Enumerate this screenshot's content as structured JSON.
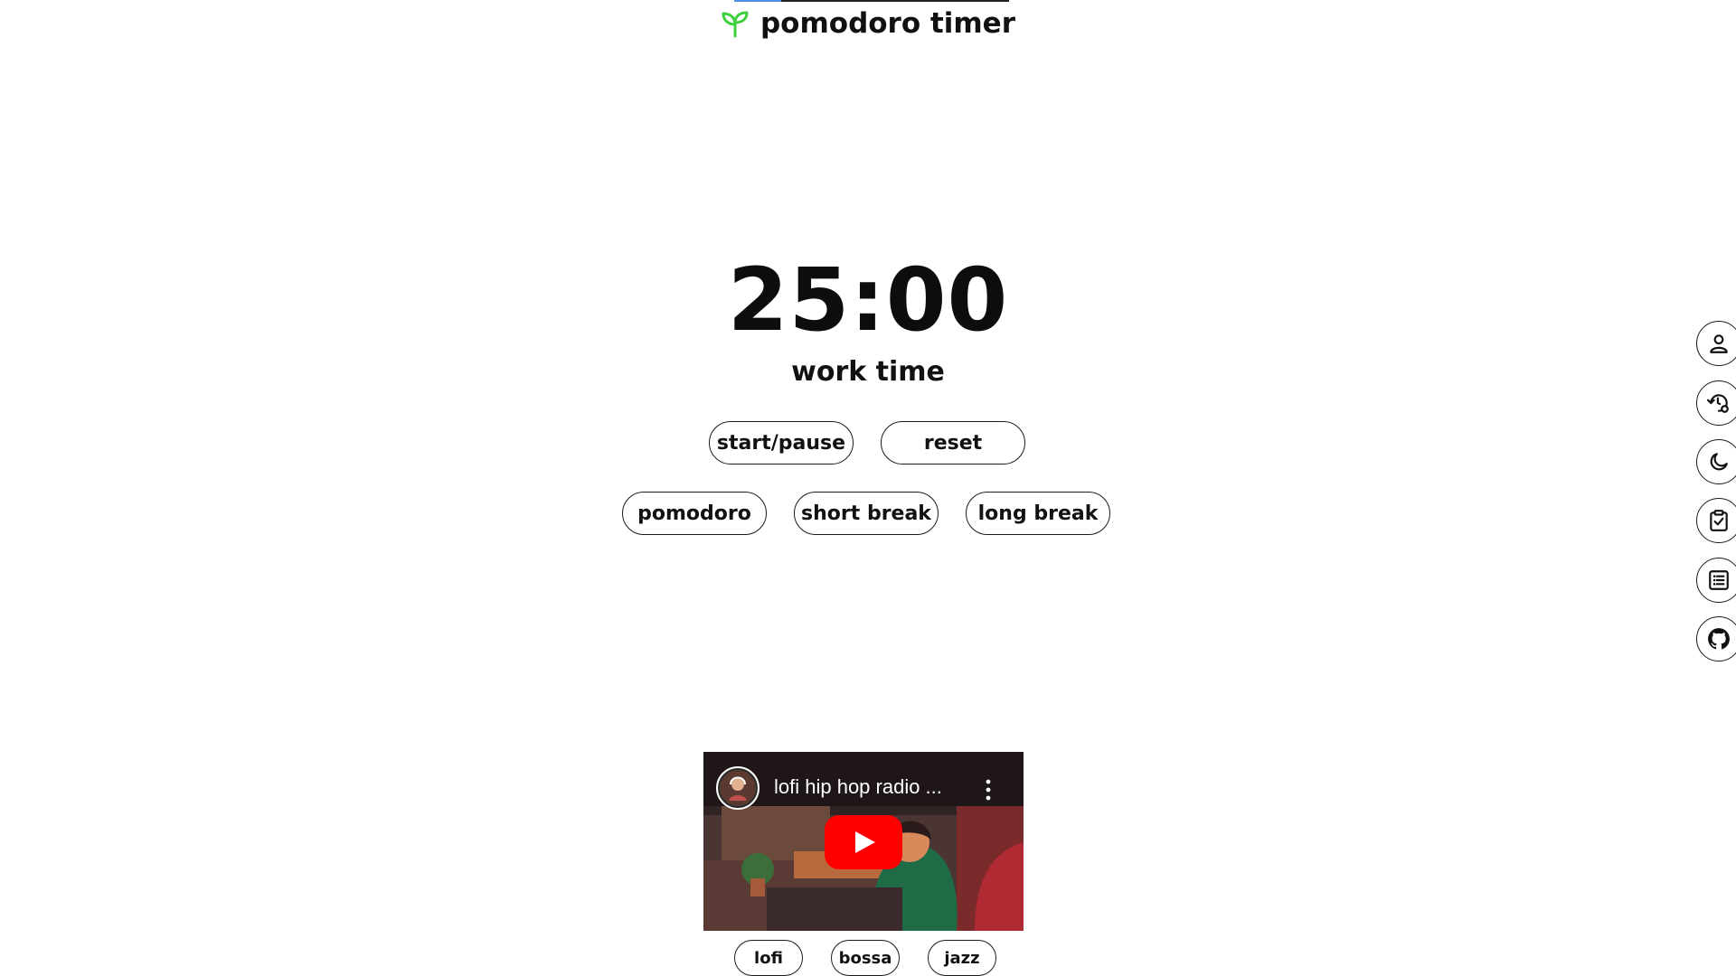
{
  "app": {
    "title": "pomodoro timer",
    "progress_fraction": 0.17
  },
  "timer": {
    "display": "25:00",
    "mode_label": "work time"
  },
  "controls": {
    "start_pause": "start/pause",
    "reset": "reset"
  },
  "modes": {
    "pomodoro": "pomodoro",
    "short_break": "short break",
    "long_break": "long break"
  },
  "video": {
    "title": "lofi hip hop radio ..."
  },
  "music": {
    "lofi": "lofi",
    "bossa": "bossa",
    "jazz": "jazz"
  },
  "dock": {
    "icons": [
      "user-icon",
      "history-settings-icon",
      "moon-icon",
      "clipboard-check-icon",
      "list-icon",
      "github-icon"
    ]
  },
  "colors": {
    "accent": "#4a90e2",
    "logo": "#3ecf3e",
    "play_button": "#ff0000"
  }
}
